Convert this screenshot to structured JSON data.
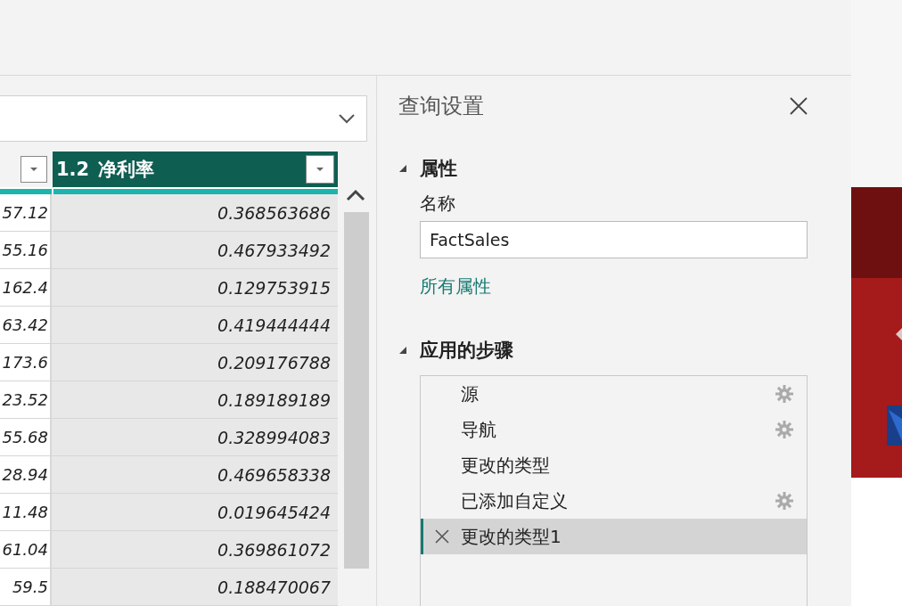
{
  "columns": [
    {
      "filter": true
    },
    {
      "name": "净利率",
      "type": "1.2",
      "filter": true
    }
  ],
  "rows": [
    [
      "57.12",
      "0.368563686"
    ],
    [
      "55.16",
      "0.467933492"
    ],
    [
      "162.4",
      "0.129753915"
    ],
    [
      "63.42",
      "0.419444444"
    ],
    [
      "173.6",
      "0.209176788"
    ],
    [
      "23.52",
      "0.189189189"
    ],
    [
      "55.68",
      "0.328994083"
    ],
    [
      "28.94",
      "0.469658338"
    ],
    [
      "11.48",
      "0.019645424"
    ],
    [
      "61.04",
      "0.369861072"
    ],
    [
      "59.5",
      "0.188470067"
    ]
  ],
  "query_settings": {
    "title": "查询设置",
    "properties": {
      "heading": "属性",
      "expanded": true,
      "name_label": "名称",
      "name_value": "FactSales",
      "all_properties_link": "所有属性"
    },
    "applied_steps": {
      "heading": "应用的步骤",
      "expanded": true,
      "steps": [
        {
          "label": "源",
          "settings": true,
          "selected": false
        },
        {
          "label": "导航",
          "settings": true,
          "selected": false
        },
        {
          "label": "更改的类型",
          "settings": false,
          "selected": false
        },
        {
          "label": "已添加自定义",
          "settings": true,
          "selected": false
        },
        {
          "label": "更改的类型1",
          "settings": false,
          "selected": true
        }
      ]
    }
  }
}
